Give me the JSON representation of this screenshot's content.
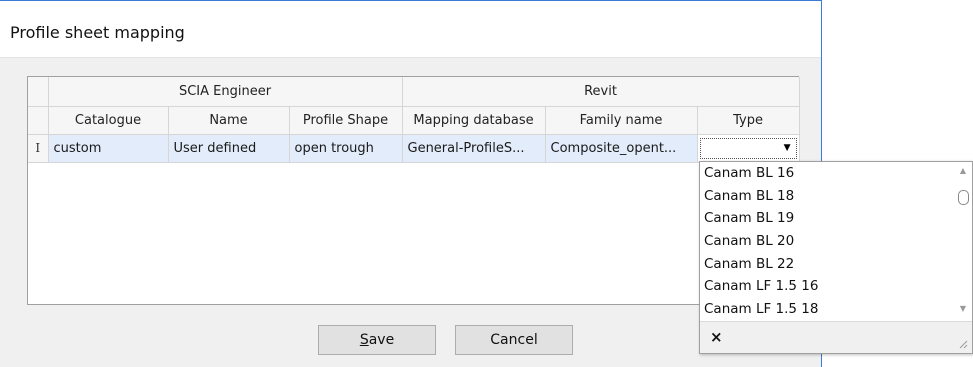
{
  "dialog": {
    "title": "Profile sheet mapping"
  },
  "grid": {
    "groups": [
      {
        "label": "SCIA Engineer"
      },
      {
        "label": "Revit"
      }
    ],
    "columns": [
      "Catalogue",
      "Name",
      "Profile Shape",
      "Mapping database",
      "Family name",
      "Type"
    ],
    "rows": [
      {
        "indicator": "I",
        "catalogue": "custom",
        "name": "User defined",
        "profile_shape": "open trough",
        "mapping_database": "General-ProfileS...",
        "family_name": "Composite_opent...",
        "type": ""
      }
    ]
  },
  "buttons": {
    "save_label": "Save",
    "cancel_label": "Cancel"
  },
  "type_dropdown": {
    "options": [
      "Canam BL 16",
      "Canam BL 18",
      "Canam BL 19",
      "Canam BL 20",
      "Canam BL 22",
      "Canam LF 1.5 16",
      "Canam LF 1.5 18"
    ],
    "close_glyph": "×",
    "icons": {
      "arrow": "chevron-down-icon",
      "scroll_up": "scroll-up-arrow-icon",
      "scroll_down": "scroll-down-arrow-icon",
      "close": "close-icon",
      "resize": "resize-grip-icon"
    }
  },
  "colors": {
    "selected_row": "#e3ecfa",
    "window_border": "#3b7bd6",
    "button_face": "#e1e1e1"
  }
}
